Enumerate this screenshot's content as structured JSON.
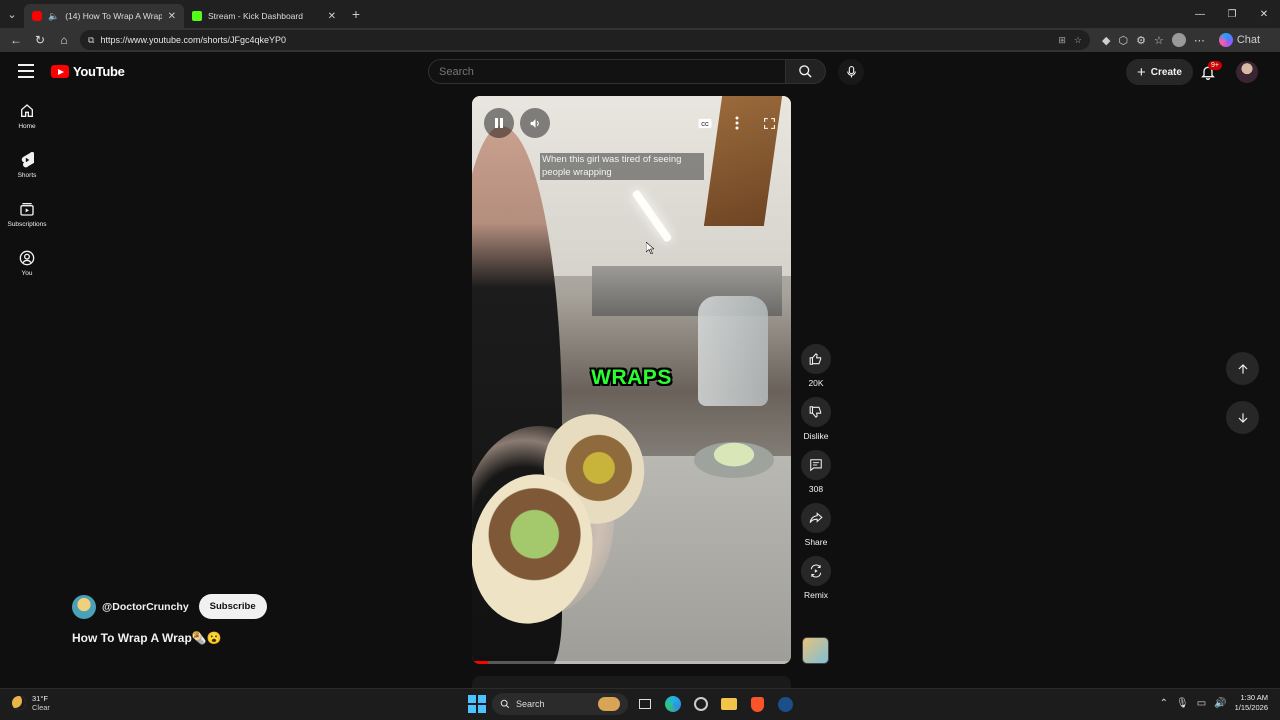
{
  "browser": {
    "tabs": [
      {
        "title": "(14) How To Wrap A Wrap🌯!",
        "active": true
      },
      {
        "title": "Stream - Kick Dashboard",
        "active": false
      }
    ],
    "url": "https://www.youtube.com/shorts/JFgc4qkeYP0",
    "chat_label": "Chat"
  },
  "header": {
    "logo_text": "YouTube",
    "search_placeholder": "Search",
    "create_label": "Create",
    "notification_badge": "9+"
  },
  "guide": [
    {
      "label": "Home",
      "icon": "home-icon"
    },
    {
      "label": "Shorts",
      "icon": "shorts-icon"
    },
    {
      "label": "Subscriptions",
      "icon": "subscriptions-icon"
    },
    {
      "label": "You",
      "icon": "you-icon"
    }
  ],
  "video": {
    "caption_top": "When this girl was tired of seeing people wrapping",
    "caption_big": "WRAPS",
    "progress_fraction": 0.05
  },
  "actions": {
    "likes": "20K",
    "dislike_label": "Dislike",
    "comments": "308",
    "share_label": "Share",
    "remix_label": "Remix"
  },
  "channel": {
    "handle": "@DoctorCrunchy",
    "subscribe_label": "Subscribe",
    "title": "How To Wrap A Wrap🌯😮"
  },
  "taskbar": {
    "weather_temp": "31°F",
    "weather_desc": "Clear",
    "search_label": "Search",
    "time": "1:30 AM",
    "date": "1/15/2026"
  },
  "colors": {
    "yt_red": "#ff0000",
    "caption_green": "#2aff33",
    "background": "#0f0f0f"
  }
}
